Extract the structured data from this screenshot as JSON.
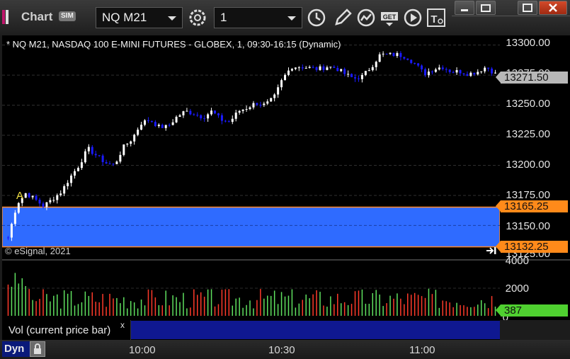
{
  "toolbar": {
    "app_title": "Chart",
    "sim_badge": "SIM",
    "symbol": "NQ M21",
    "interval": "1",
    "icons": [
      "settings-gear-icon",
      "clock-icon",
      "pencil-draw-icon",
      "chart-study-icon",
      "get-data-icon",
      "play-icon",
      "text-tool-icon"
    ],
    "window_buttons": [
      "minimize-icon",
      "restore-icon",
      "maximize-icon",
      "close-icon"
    ]
  },
  "chart": {
    "title": "* NQ M21, NASDAQ 100 E-MINI FUTURES - GLOBEX, 1, 09:30-16:15 (Dynamic)",
    "copyright": "© eSignal, 2021",
    "marker_label": "A",
    "price_axis_labels": [
      "13300.00",
      "13275.00",
      "13250.00",
      "13225.00",
      "13200.00",
      "13175.00",
      "13150.00",
      "13125.00"
    ],
    "last_price": "13271.50",
    "range_high": "13165.25",
    "range_low": "13132.25",
    "volume_axis_labels": [
      "4000",
      "2000",
      "0"
    ],
    "volume_last": "387",
    "time_labels": [
      "10:00",
      "10:30",
      "11:00"
    ],
    "colors": {
      "background": "#000000",
      "up_candle": "#ffffff",
      "down_candle": "#1a1aff",
      "range_fill": "#2f6bff",
      "range_border": "#ff8a2a",
      "vol_up": "#5fe05f",
      "vol_down": "#ff3a2a",
      "last_price_pill": "#b8b8b8",
      "range_pill": "#ff8a1a",
      "volume_pill": "#4fd030"
    }
  },
  "study": {
    "label": "Vol (current price bar)",
    "close": "x"
  },
  "footer": {
    "mode": "Dyn"
  },
  "chart_data": {
    "type": "candlestick",
    "symbol": "NQ M21",
    "interval": "1",
    "y_range": [
      13122,
      13308
    ],
    "x_labels": [
      "10:00",
      "10:30",
      "11:00"
    ],
    "ohlc_path": [
      13140,
      13168,
      13177,
      13172,
      13166,
      13172,
      13178,
      13190,
      13200,
      13214,
      13208,
      13202,
      13200,
      13215,
      13222,
      13235,
      13238,
      13232,
      13232,
      13240,
      13245,
      13243,
      13240,
      13245,
      13238,
      13236,
      13245,
      13248,
      13252,
      13250,
      13256,
      13272,
      13282,
      13282,
      13281,
      13280,
      13282,
      13281,
      13276,
      13272,
      13274,
      13282,
      13292,
      13292,
      13292,
      13290,
      13284,
      13276,
      13280,
      13282,
      13278,
      13278,
      13276,
      13278,
      13282,
      13276
    ],
    "volume_range": [
      0,
      4000
    ],
    "volume_last": 387
  }
}
